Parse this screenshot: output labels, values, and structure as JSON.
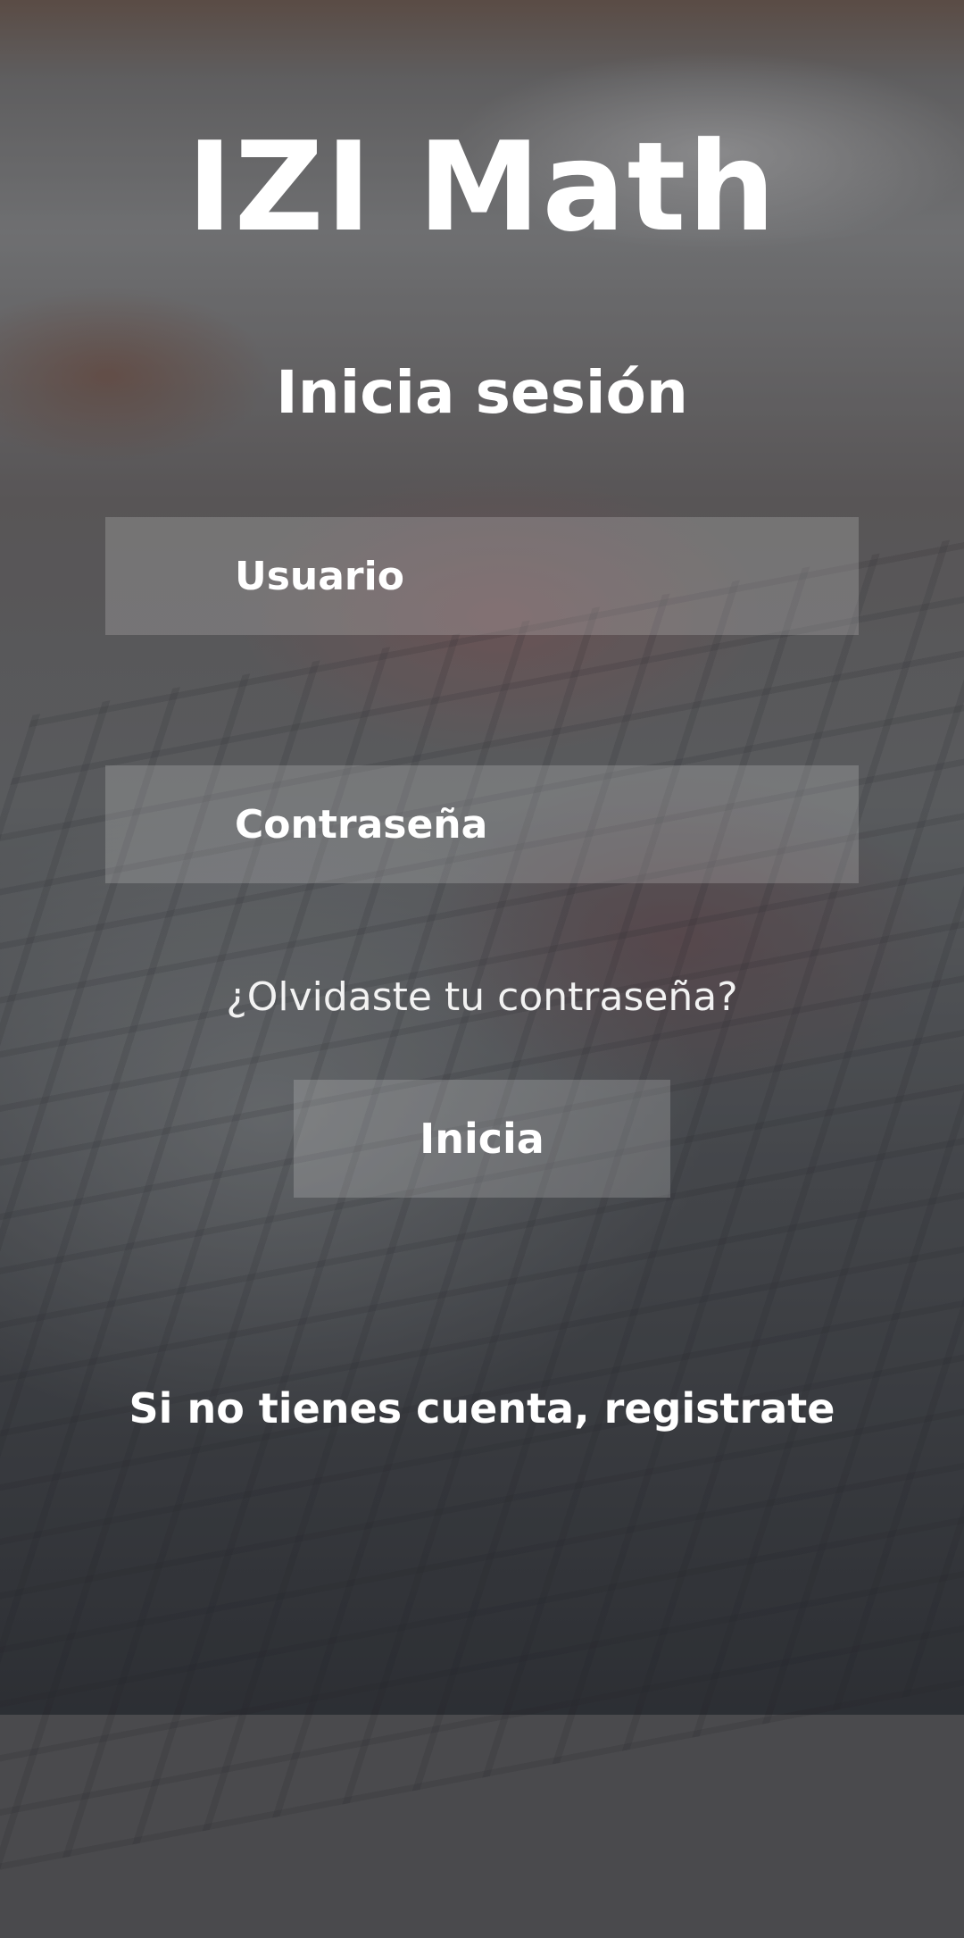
{
  "app": {
    "title": "IZI Math"
  },
  "login": {
    "heading": "Inicia sesión",
    "username_placeholder": "Usuario",
    "password_placeholder": "Contraseña",
    "forgot_password": "¿Olvidaste tu contraseña?",
    "submit_label": "Inicia",
    "register_prompt": "Si no tienes cuenta, registrate"
  },
  "colors": {
    "text": "#ffffff",
    "field_background": "rgba(225,225,225,0.22)"
  }
}
